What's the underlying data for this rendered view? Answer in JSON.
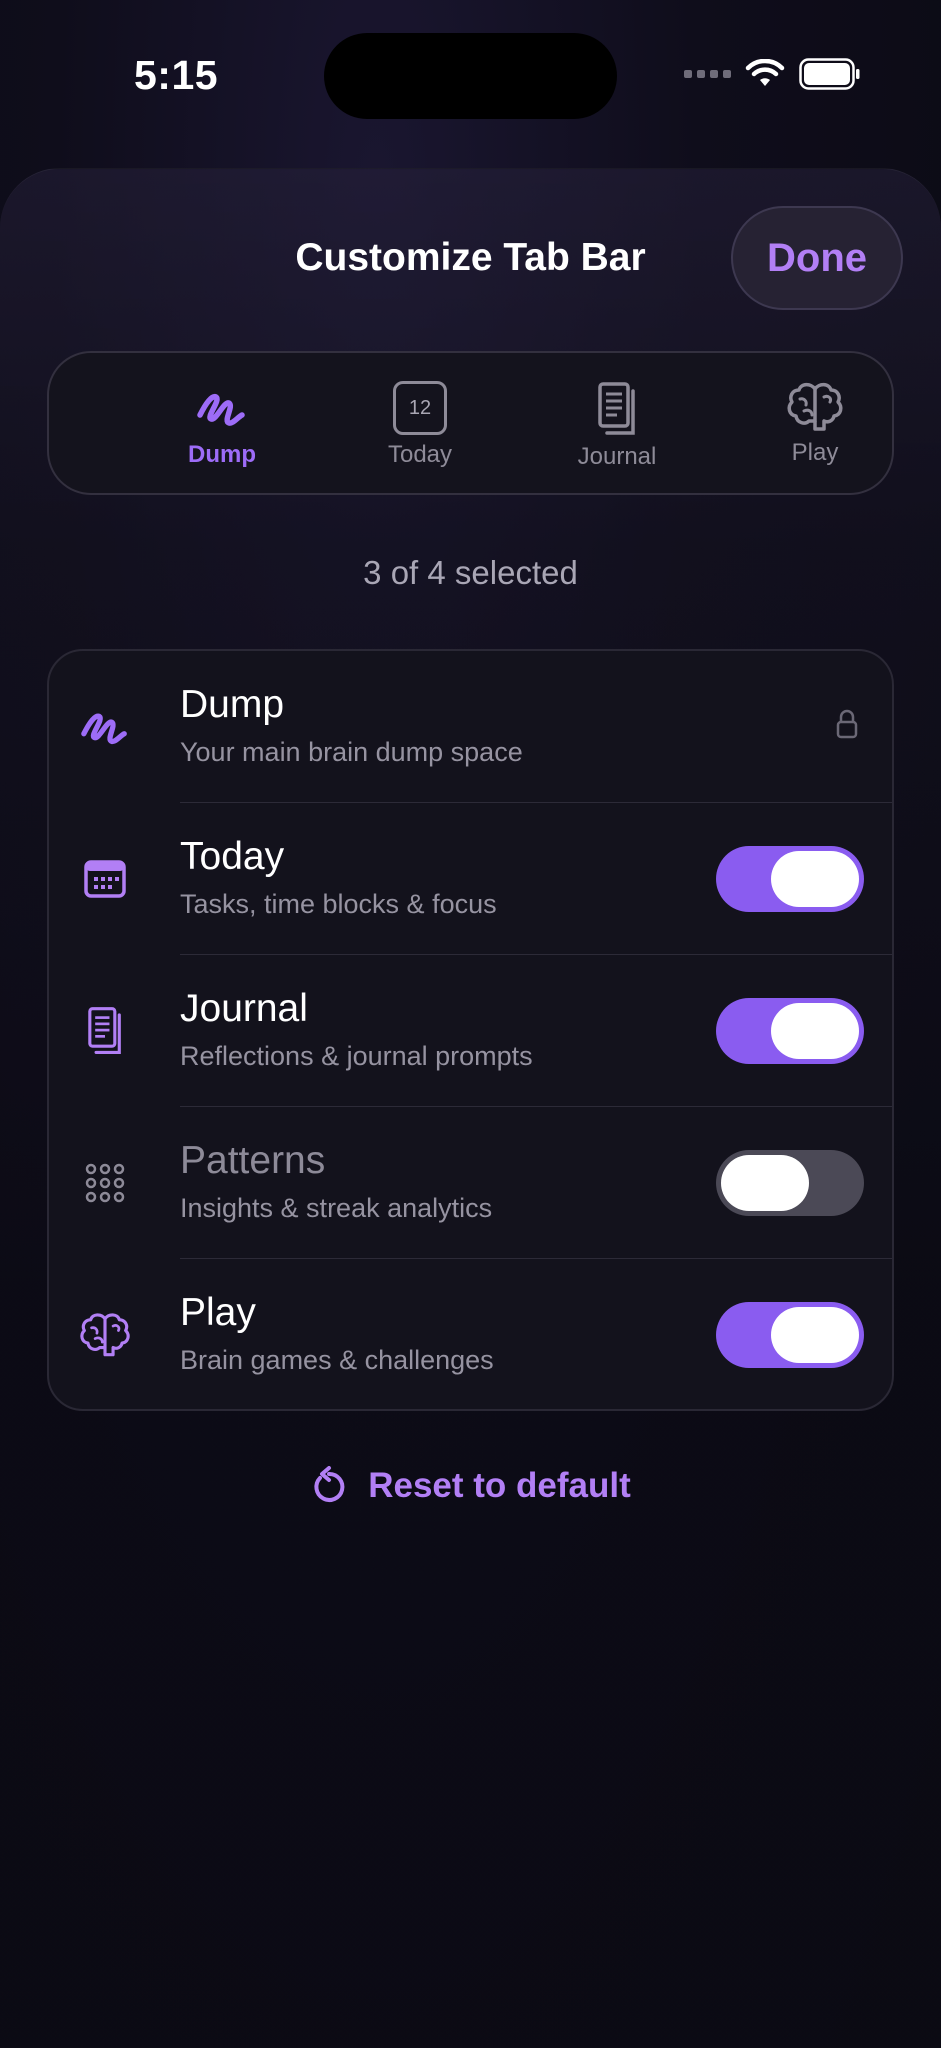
{
  "status_bar": {
    "time": "5:15"
  },
  "header": {
    "title": "Customize Tab Bar",
    "done_label": "Done"
  },
  "preview_tabs": [
    {
      "label": "Dump",
      "icon": "scribble-icon",
      "active": true
    },
    {
      "label": "Today",
      "icon": "calendar-icon",
      "day": "12"
    },
    {
      "label": "Journal",
      "icon": "journal-icon"
    },
    {
      "label": "Play",
      "icon": "brain-icon"
    }
  ],
  "selection_count": "3 of 4 selected",
  "tabs": [
    {
      "name": "Dump",
      "desc": "Your main brain dump space",
      "icon": "scribble-icon",
      "locked": true
    },
    {
      "name": "Today",
      "desc": "Tasks, time blocks & focus",
      "icon": "calendar-icon",
      "enabled": true
    },
    {
      "name": "Journal",
      "desc": "Reflections & journal prompts",
      "icon": "journal-icon",
      "enabled": true
    },
    {
      "name": "Patterns",
      "desc": "Insights & streak analytics",
      "icon": "dots-grid-icon",
      "enabled": false
    },
    {
      "name": "Play",
      "desc": "Brain games & challenges",
      "icon": "brain-icon",
      "enabled": true
    }
  ],
  "reset_label": "Reset to default",
  "colors": {
    "accent": "#8a5cf0",
    "accent_text": "#b27ff5",
    "background": "#0c0b14"
  }
}
